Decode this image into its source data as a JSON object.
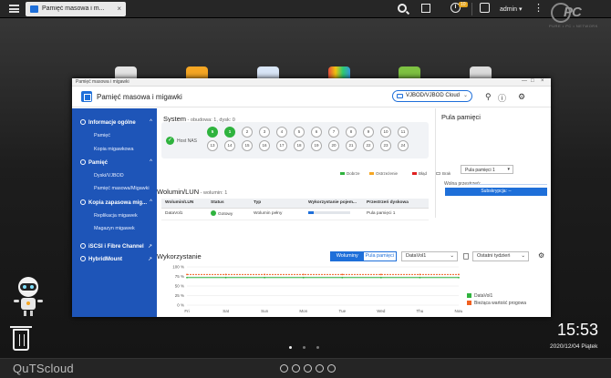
{
  "topbar": {
    "tab_label": "Pamięć masowa i m...",
    "tab_close": "×",
    "info_badge": "10",
    "user": "admin ▾",
    "more": "⋮",
    "logo_text": "PC",
    "logo_sub": "PURE • PC • NETWORK"
  },
  "window": {
    "titlebar": "Pamięć masowa i migawki",
    "controls": {
      "min": "—",
      "max": "□",
      "close": "×"
    },
    "title": "Pamięć masowa i migawki",
    "cloud_select": "VJBOD/VJBOD Cloud",
    "cloud_chevron": "⌄"
  },
  "sidebar": {
    "sections": [
      {
        "label": "Informacje ogólne",
        "items": [
          "Pamięć",
          "Kopia migawkowa"
        ]
      },
      {
        "label": "Pamięć",
        "items": [
          "Dyski/VJBOD",
          "Pamięć masowa/Migawki"
        ]
      },
      {
        "label": "Kopia zapasowa mig...",
        "items": [
          "Replikacja migawek",
          "Magazyn migawek"
        ]
      }
    ],
    "links": [
      "iSCSI i Fibre Channel",
      "HybridMount"
    ]
  },
  "system": {
    "title": "System",
    "sub": " - obudowa: 1, dysk: 0",
    "host_label": "Host NAS",
    "bays_row1": [
      "5",
      "1",
      "2",
      "3",
      "4",
      "5",
      "6",
      "7",
      "8",
      "9",
      "10",
      "11"
    ],
    "bays_row2": [
      "13",
      "14",
      "15",
      "16",
      "17",
      "18",
      "19",
      "20",
      "21",
      "22",
      "23",
      "24"
    ],
    "active_bays": [
      0,
      1
    ],
    "legend": [
      {
        "label": "Dobrze",
        "color": "#2fb33e"
      },
      {
        "label": "Ostrzeżenie",
        "color": "#f5a623"
      },
      {
        "label": "Błąd",
        "color": "#e02020"
      },
      {
        "label": "Brak",
        "color": "#ffffff"
      }
    ]
  },
  "pool": {
    "title": "Pula pamięci",
    "select": "Pula pamięci 1",
    "free_label": "Wolna przestrzeń:",
    "subscribe_button": "Subskrypcja: --"
  },
  "volumes": {
    "title": "Wolumin/LUN",
    "sub": " - wolumin: 1",
    "headers": [
      "Wolumin/LUN",
      "Status",
      "Typ",
      "Wykorzystanie pojem...",
      "Przestrzeń dyskowa"
    ],
    "rows": [
      [
        "DataVol1",
        "Gotowy",
        "Wolumin pełny",
        "",
        "Pula pamięci 1"
      ]
    ]
  },
  "usage": {
    "title": "Wykorzystanie",
    "seg_volumes": "Woluminy",
    "seg_pool": "Pula pamięci",
    "volume_select": "DataVol1",
    "range_select": "Ostatni tydzień",
    "chevron": "⌄",
    "gear": "⚙"
  },
  "chart_data": {
    "type": "line",
    "x": [
      "Fri",
      "Sat",
      "Sun",
      "Mon",
      "Tue",
      "Wed",
      "Thu",
      "Now"
    ],
    "yticks": [
      "100 %",
      "75 %",
      "50 %",
      "25 %",
      "0 %"
    ],
    "ylim": [
      0,
      100
    ],
    "series": [
      {
        "name": "DataVol1",
        "color": "#2fb33e",
        "values": [
          72,
          72,
          72,
          72,
          72,
          72,
          72,
          72
        ]
      },
      {
        "name": "Bieżąca wartość progowa",
        "color": "#f06020",
        "values": [
          80,
          80,
          80,
          80,
          80,
          80,
          80,
          80
        ]
      }
    ]
  },
  "desktop": {
    "time": "15:53",
    "date": "2020/12/04 Piątek",
    "brand": "QuTScloud"
  },
  "colors": {
    "accent": "#1e6fd9",
    "sidebar": "#1e55b8",
    "ok": "#2fb33e"
  }
}
